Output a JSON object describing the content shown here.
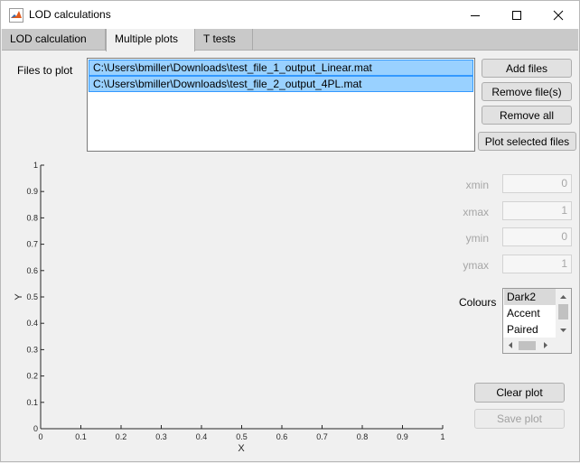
{
  "window": {
    "title": "LOD calculations",
    "controls": {
      "minimize": "minimize",
      "maximize": "maximize",
      "close": "close"
    }
  },
  "tabs": [
    {
      "label": "LOD calculation",
      "active": false
    },
    {
      "label": "Multiple plots",
      "active": true
    },
    {
      "label": "T tests",
      "active": false
    }
  ],
  "files": {
    "label": "Files to plot",
    "items": [
      "C:\\Users\\bmiller\\Downloads\\test_file_1_output_Linear.mat",
      "C:\\Users\\bmiller\\Downloads\\test_file_2_output_4PL.mat"
    ]
  },
  "buttons": {
    "add_files": "Add files",
    "remove_files": "Remove file(s)",
    "remove_all": "Remove all",
    "plot_selected": "Plot selected files",
    "clear_plot": "Clear plot",
    "save_plot": "Save plot"
  },
  "limits": {
    "xmin": {
      "label": "xmin",
      "value": "0"
    },
    "xmax": {
      "label": "xmax",
      "value": "1"
    },
    "ymin": {
      "label": "ymin",
      "value": "0"
    },
    "ymax": {
      "label": "ymax",
      "value": "1"
    }
  },
  "colours": {
    "label": "Colours",
    "options": [
      "Dark2",
      "Accent",
      "Paired"
    ],
    "selected": "Dark2"
  },
  "chart_data": {
    "type": "line",
    "series": [],
    "xlabel": "X",
    "ylabel": "Y",
    "xlim": [
      0,
      1
    ],
    "ylim": [
      0,
      1
    ],
    "xticks": [
      "0",
      "0.1",
      "0.2",
      "0.3",
      "0.4",
      "0.5",
      "0.6",
      "0.7",
      "0.8",
      "0.9",
      "1"
    ],
    "yticks": [
      "0",
      "0.1",
      "0.2",
      "0.3",
      "0.4",
      "0.5",
      "0.6",
      "0.7",
      "0.8",
      "0.9",
      "1"
    ],
    "grid": false
  },
  "colors": {
    "selection_fill": "#99d1ff",
    "selection_border": "#3399ff",
    "tab_strip": "#c9c9c9"
  }
}
